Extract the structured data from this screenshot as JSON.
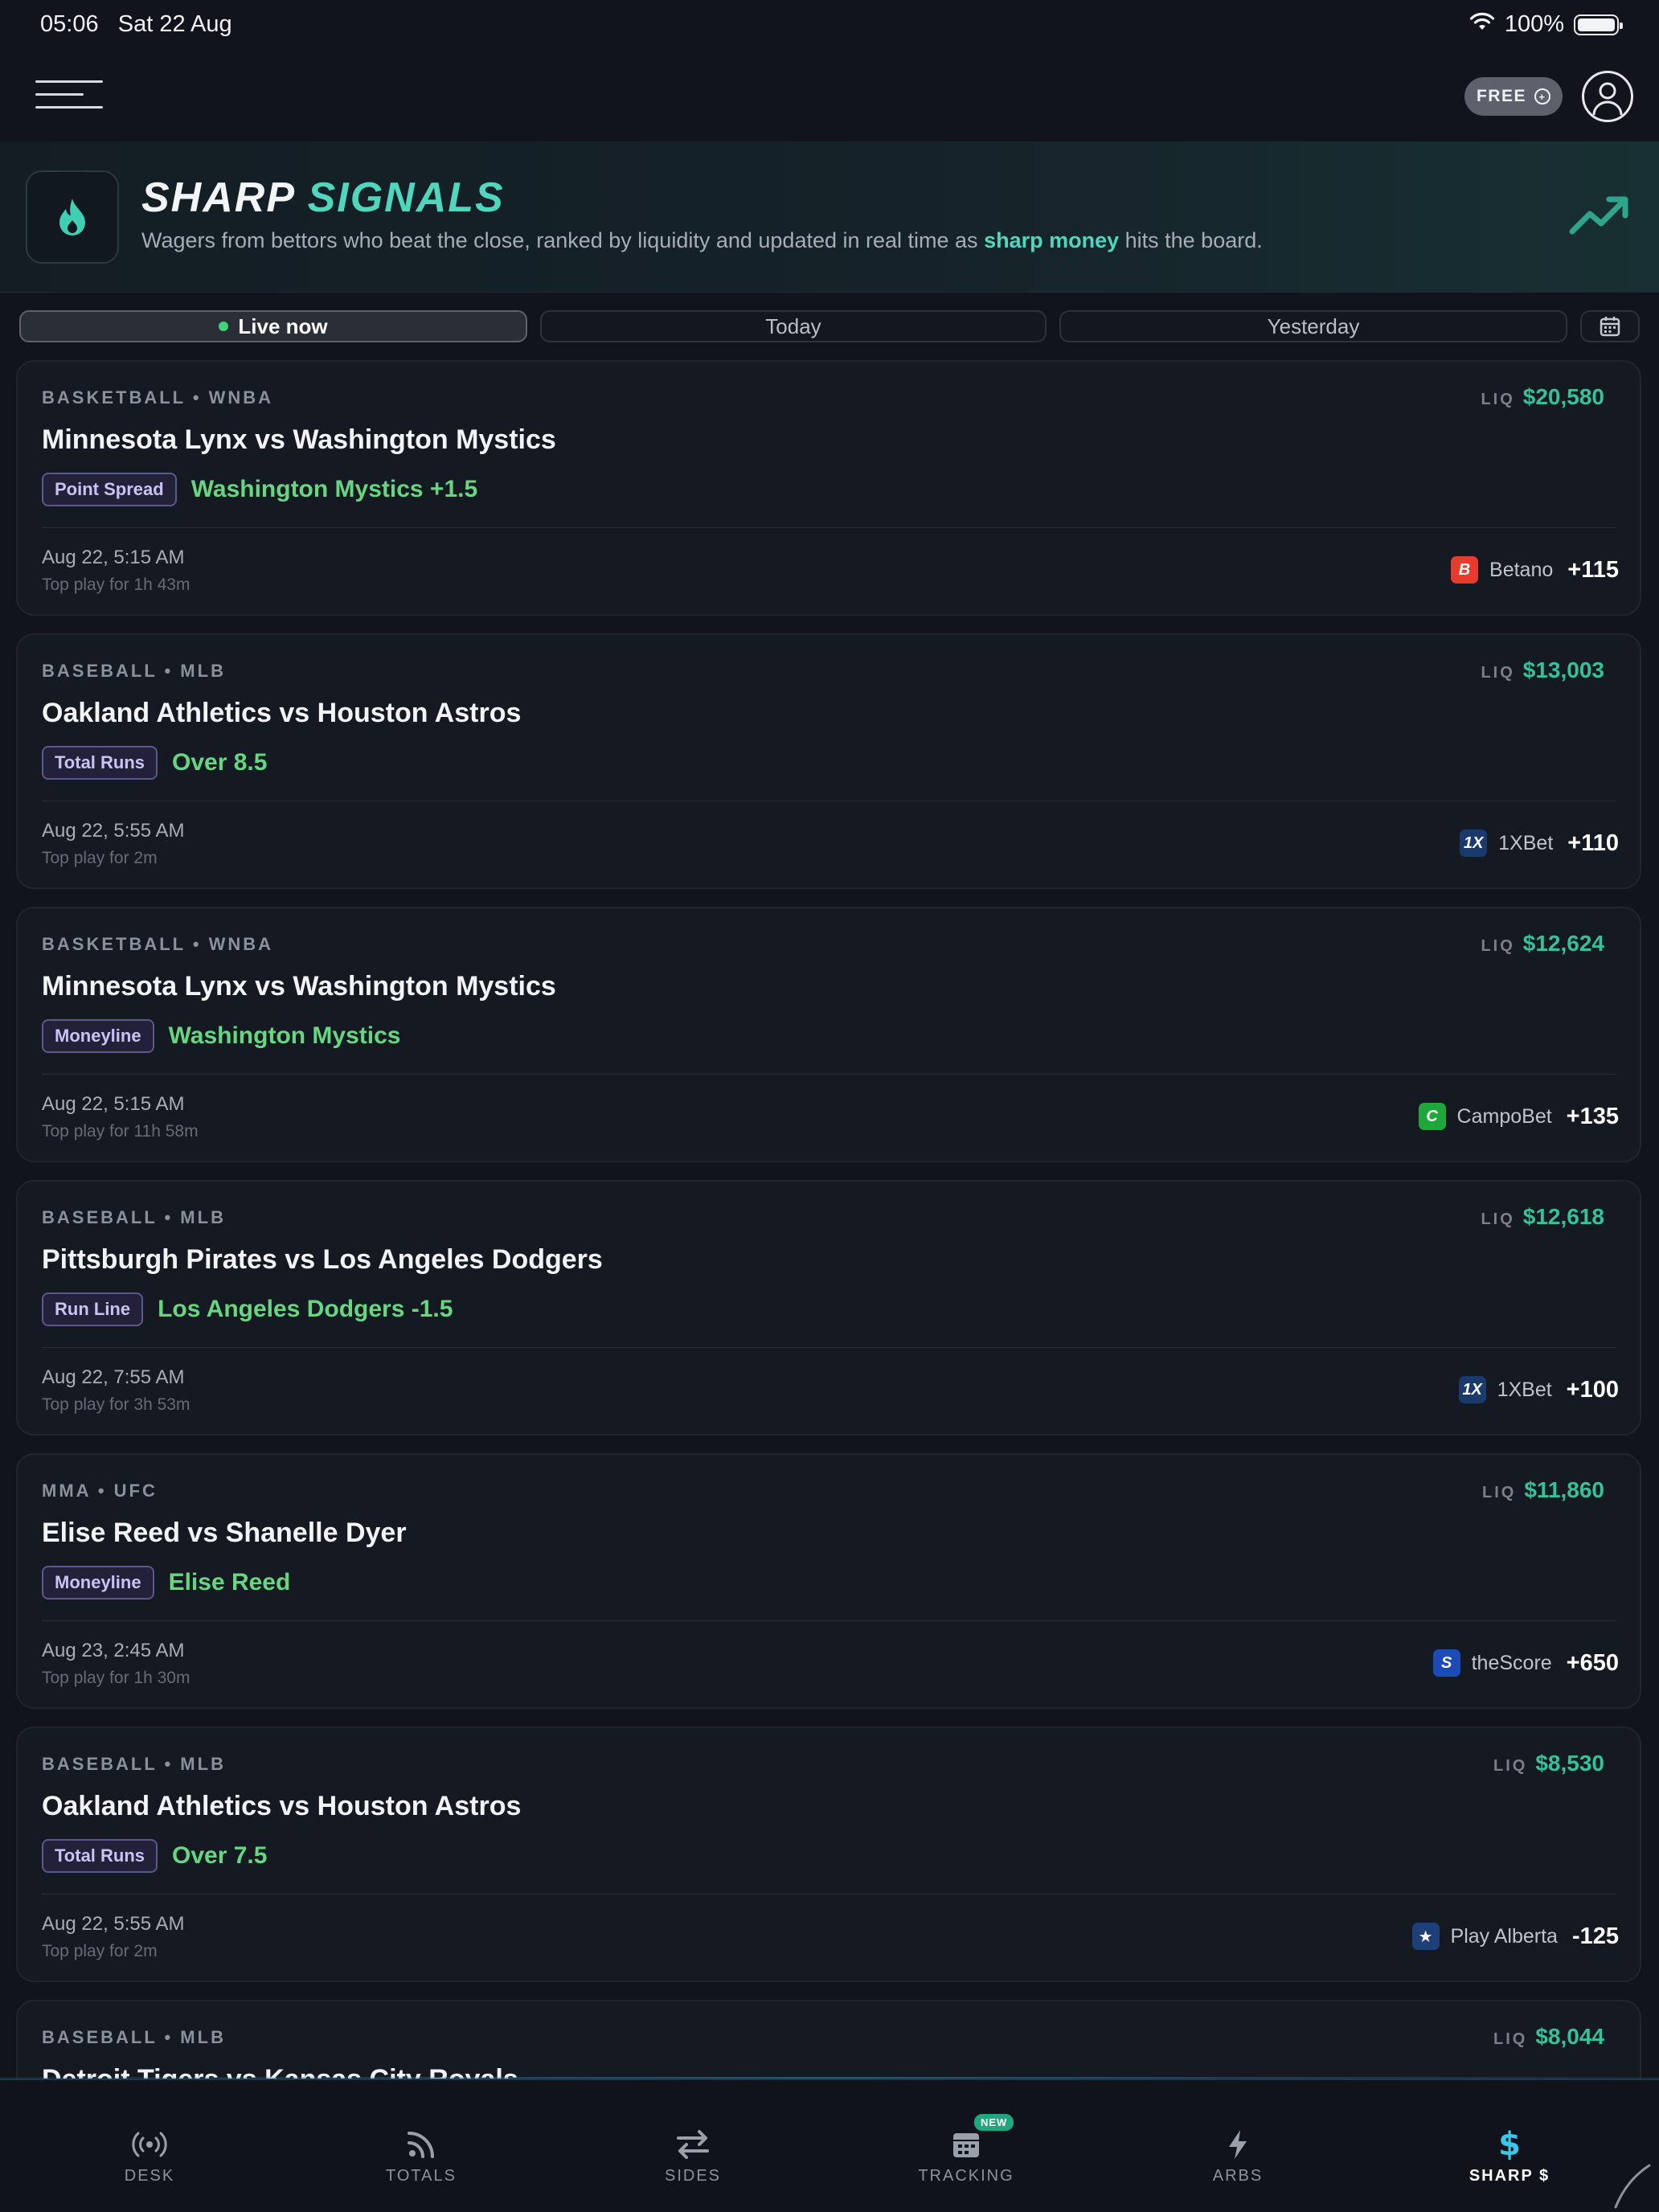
{
  "status_bar": {
    "time": "05:06",
    "date": "Sat 22 Aug",
    "battery": "100%"
  },
  "header": {
    "plan_label": "FREE"
  },
  "hero": {
    "title_part1": "SHARP",
    "title_part2": "SIGNALS",
    "desc_before": "Wagers from bettors who beat the close, ranked by liquidity and updated in real time as ",
    "desc_highlight": "sharp money",
    "desc_after": " hits the board."
  },
  "tabs": [
    {
      "label": "Live now"
    },
    {
      "label": "Today"
    },
    {
      "label": "Yesterday"
    }
  ],
  "liq_label": "LIQ",
  "cards": [
    {
      "league": "BASKETBALL • WNBA",
      "liq": "$20,580",
      "title": "Minnesota Lynx vs Washington Mystics",
      "bet_type": "Point Spread",
      "pick": "Washington Mystics +1.5",
      "date": "Aug 22, 5:15 AM",
      "top_play": "Top play for 1h 43m",
      "book": "Betano",
      "book_logo": "B",
      "book_color": "#e83a2e",
      "odds": "+115"
    },
    {
      "league": "BASEBALL • MLB",
      "liq": "$13,003",
      "title": "Oakland Athletics vs Houston Astros",
      "bet_type": "Total Runs",
      "pick": "Over 8.5",
      "date": "Aug 22, 5:55 AM",
      "top_play": "Top play for 2m",
      "book": "1XBet",
      "book_logo": "1X",
      "book_color": "#1a3a6e",
      "odds": "+110"
    },
    {
      "league": "BASKETBALL • WNBA",
      "liq": "$12,624",
      "title": "Minnesota Lynx vs Washington Mystics",
      "bet_type": "Moneyline",
      "pick": "Washington Mystics",
      "date": "Aug 22, 5:15 AM",
      "top_play": "Top play for 11h 58m",
      "book": "CampoBet",
      "book_logo": "C",
      "book_color": "#1fa83a",
      "odds": "+135"
    },
    {
      "league": "BASEBALL • MLB",
      "liq": "$12,618",
      "title": "Pittsburgh Pirates vs Los Angeles Dodgers",
      "bet_type": "Run Line",
      "pick": "Los Angeles Dodgers -1.5",
      "date": "Aug 22, 7:55 AM",
      "top_play": "Top play for 3h 53m",
      "book": "1XBet",
      "book_logo": "1X",
      "book_color": "#1a3a6e",
      "odds": "+100"
    },
    {
      "league": "MMA • UFC",
      "liq": "$11,860",
      "title": "Elise Reed vs Shanelle Dyer",
      "bet_type": "Moneyline",
      "pick": "Elise Reed",
      "date": "Aug 23, 2:45 AM",
      "top_play": "Top play for 1h 30m",
      "book": "theScore",
      "book_logo": "S",
      "book_color": "#1c4bb8",
      "odds": "+650"
    },
    {
      "league": "BASEBALL • MLB",
      "liq": "$8,530",
      "title": "Oakland Athletics vs Houston Astros",
      "bet_type": "Total Runs",
      "pick": "Over 7.5",
      "date": "Aug 22, 5:55 AM",
      "top_play": "Top play for 2m",
      "book": "Play Alberta",
      "book_logo": "★",
      "book_color": "#1d3f7a",
      "odds": "-125"
    },
    {
      "league": "BASEBALL • MLB",
      "liq": "$8,044",
      "title": "Detroit Tigers vs Kansas City Royals",
      "bet_type": "",
      "pick": "",
      "date": "",
      "top_play": "",
      "book": "",
      "book_logo": "",
      "book_color": "#1a3a6e",
      "odds": ""
    }
  ],
  "nav": [
    {
      "label": "DESK",
      "icon": "broadcast-icon"
    },
    {
      "label": "TOTALS",
      "icon": "rss-icon"
    },
    {
      "label": "SIDES",
      "icon": "swap-arrows-icon"
    },
    {
      "label": "TRACKING",
      "icon": "calendar-icon",
      "badge": "NEW"
    },
    {
      "label": "ARBS",
      "icon": "lightning-icon"
    },
    {
      "label": "SHARP $",
      "icon": "dollar-icon"
    }
  ]
}
